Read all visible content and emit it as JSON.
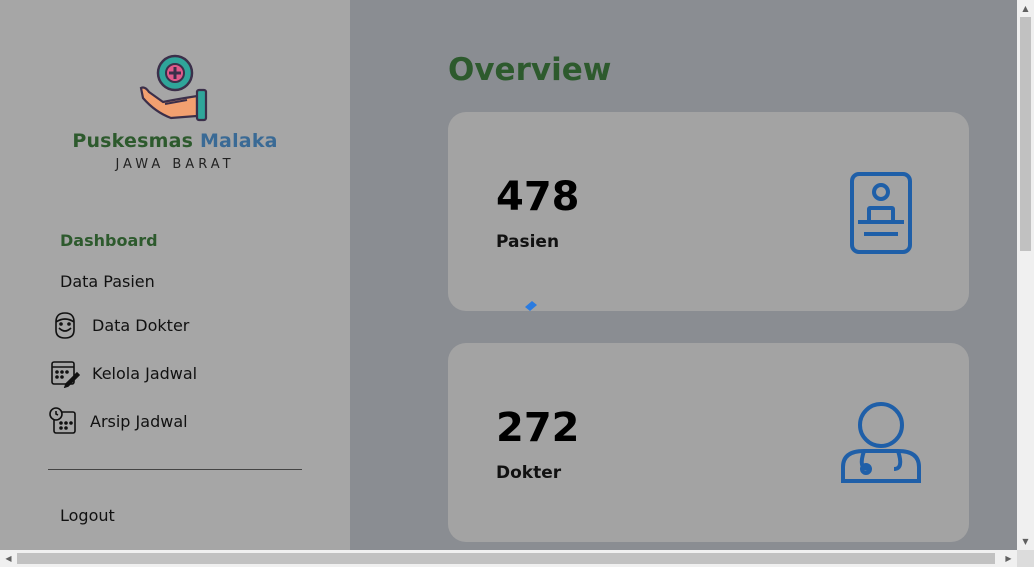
{
  "brand": {
    "name_part1": "Puskesmas",
    "name_part2": "Malaka",
    "region": "JAWA BARAT"
  },
  "nav": {
    "dashboard": "Dashboard",
    "data_pasien": "Data Pasien",
    "data_dokter": "Data Dokter",
    "kelola_jadwal": "Kelola Jadwal",
    "arsip_jadwal": "Arsip Jadwal",
    "logout": "Logout"
  },
  "main": {
    "title": "Overview",
    "cards": [
      {
        "value": "478",
        "label": "Pasien",
        "icon": "patient-id-card-icon"
      },
      {
        "value": "272",
        "label": "Dokter",
        "icon": "doctor-icon"
      }
    ]
  },
  "colors": {
    "green": "#2d5a2d",
    "blue": "#3a6a95",
    "icon_blue": "#1f5fa8"
  }
}
